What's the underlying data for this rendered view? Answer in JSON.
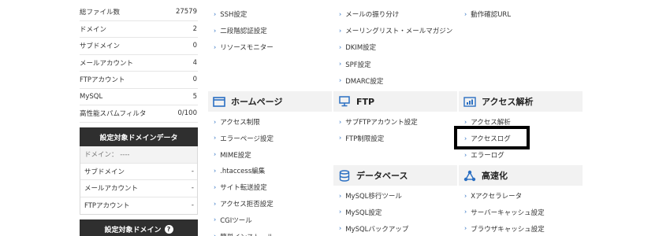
{
  "stats": [
    {
      "label": "総ファイル数",
      "value": "27579"
    },
    {
      "label": "ドメイン",
      "value": "2"
    },
    {
      "label": "サブドメイン",
      "value": "0"
    },
    {
      "label": "メールアカウント",
      "value": "4"
    },
    {
      "label": "FTPアカウント",
      "value": "0"
    },
    {
      "label": "MySQL",
      "value": "5"
    },
    {
      "label": "高性能スパムフィルタ",
      "value": "0/100"
    }
  ],
  "target_domain_data": {
    "title": "設定対象ドメインデータ",
    "domain_label": "ドメイン： ----",
    "rows": [
      {
        "label": "サブドメイン",
        "value": "-"
      },
      {
        "label": "メールアカウント",
        "value": "-"
      },
      {
        "label": "FTPアカウント",
        "value": "-"
      }
    ]
  },
  "target_domain": {
    "title": "設定対象ドメイン",
    "help": "?"
  },
  "col1": {
    "top_links": [
      "SSH設定",
      "二段階認証設定",
      "リソースモニター"
    ],
    "section_title": "ホームページ",
    "links": [
      "アクセス制限",
      "エラーページ設定",
      "MIME設定",
      ".htaccess編集",
      "サイト転送設定",
      "アクセス拒否設定",
      "CGIツール",
      "簡単インストール"
    ]
  },
  "col2": {
    "top_links": [
      "メールの振り分け",
      "メーリングリスト・メールマガジン",
      "DKIM設定",
      "SPF設定",
      "DMARC設定"
    ],
    "ftp_title": "FTP",
    "ftp_links": [
      "サブFTPアカウント設定",
      "FTP制限設定"
    ],
    "db_title": "データベース",
    "db_links": [
      "MySQL移行ツール",
      "MySQL設定",
      "MySQLバックアップ"
    ]
  },
  "col3": {
    "top_links": [
      "動作確認URL"
    ],
    "access_title": "アクセス解析",
    "access_links": [
      "アクセス解析",
      "アクセスログ",
      "エラーログ"
    ],
    "speed_title": "高速化",
    "speed_links": [
      "Xアクセラレータ",
      "サーバーキャッシュ設定",
      "ブラウザキャッシュ設定"
    ]
  },
  "colors": {
    "accent": "#2b6fc2",
    "dark_header": "#2f2f2f",
    "section_bg": "#f2f2f2",
    "highlight": "#000000"
  }
}
